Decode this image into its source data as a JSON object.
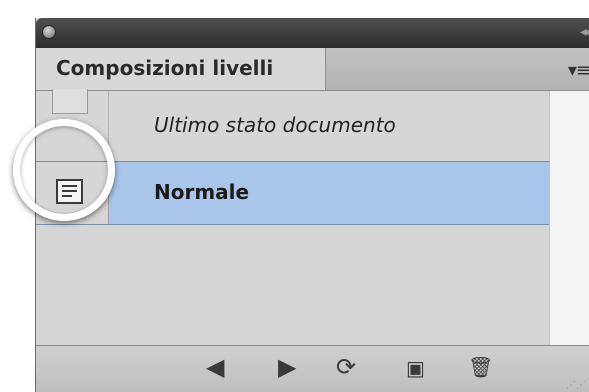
{
  "panel": {
    "tab_label": "Composizioni livelli",
    "collapse_glyph": "◂◂",
    "menu_glyph": "▾≡"
  },
  "rows": [
    {
      "label": "Ultimo stato documento",
      "selected": false,
      "icon": "empty-slot"
    },
    {
      "label": "Normale",
      "selected": true,
      "icon": "layer-comp-icon"
    }
  ],
  "bottom_toolbar": {
    "prev": "◀",
    "next": "▶",
    "update": "⟳",
    "new": "▣",
    "delete": "🗑"
  },
  "colors": {
    "selected_row": "#a9c6ea",
    "panel_bg": "#d6d6d6",
    "titlebar": "#3a3a3a"
  }
}
